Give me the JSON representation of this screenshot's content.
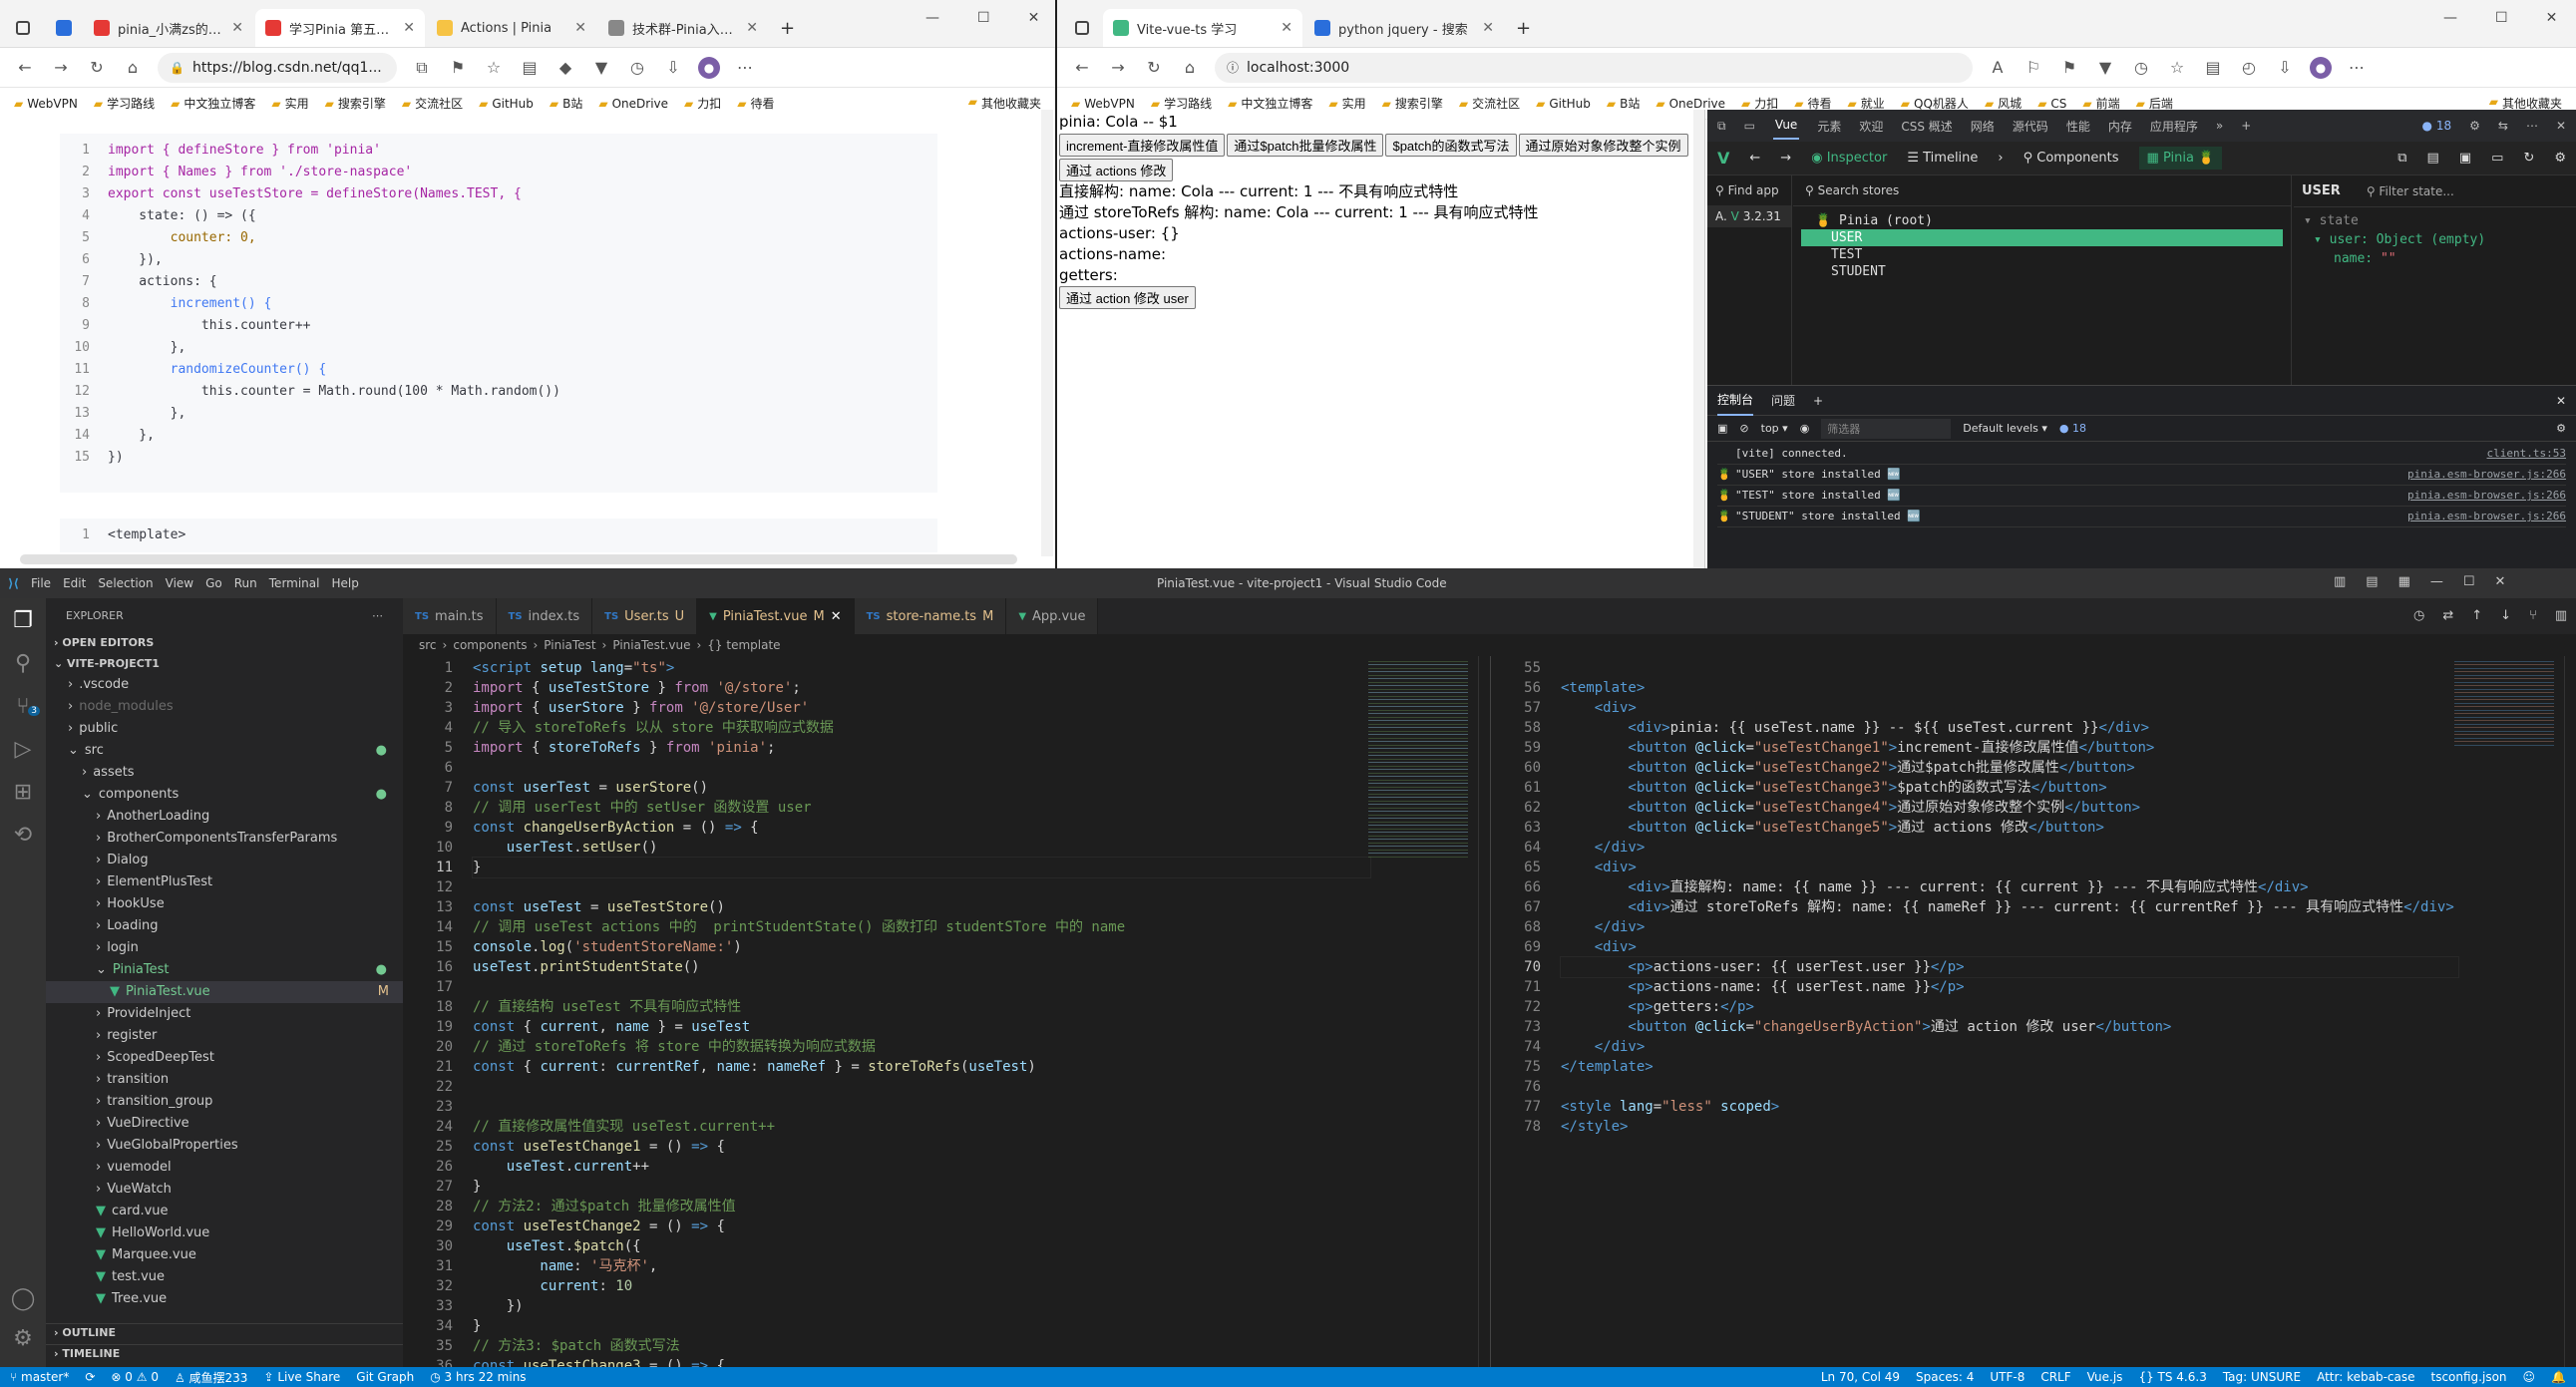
{
  "left_browser": {
    "tabs": [
      {
        "label": "pinia_小满zs的博客-CS",
        "color": "#e53935"
      },
      {
        "label": "学习Pinia 第五章（Acti",
        "color": "#e53935"
      },
      {
        "label": "Actions | Pinia",
        "color": "#f6c344"
      },
      {
        "label": "技术群-Pinia入门视频-",
        "color": "#888888"
      }
    ],
    "url": "https://blog.csdn.net/qq1...",
    "bookmarks": [
      "WebVPN",
      "学习路线",
      "中文独立博客",
      "实用",
      "搜索引擎",
      "交流社区",
      "GitHub",
      "B站",
      "OneDrive",
      "力扣",
      "待看"
    ],
    "other_bookmarks": "其他收藏夹",
    "code_lines": [
      "import { defineStore } from 'pinia'",
      "import { Names } from './store-naspace'",
      "export const useTestStore = defineStore(Names.TEST, {",
      "    state: () => ({",
      "        counter: 0,",
      "    }),",
      "    actions: {",
      "        increment() {",
      "            this.counter++",
      "        },",
      "        randomizeCounter() {",
      "            this.counter = Math.round(100 * Math.random())",
      "        },",
      "    },",
      "})"
    ],
    "code2_line": "<template>"
  },
  "right_browser": {
    "tabs": [
      {
        "label": "Vite-vue-ts 学习",
        "color": "#41b883"
      },
      {
        "label": "python jquery - 搜索",
        "color": "#2a6edb"
      }
    ],
    "url": "localhost:3000",
    "bookmarks": [
      "WebVPN",
      "学习路线",
      "中文独立博客",
      "实用",
      "搜索引擎",
      "交流社区",
      "GitHub",
      "B站",
      "OneDrive",
      "力扣",
      "待看",
      "就业",
      "QQ机器人",
      "风城",
      "CS",
      "前端",
      "后端"
    ],
    "other_bookmarks": "其他收藏夹"
  },
  "app": {
    "title_line": "pinia: Cola -- $1",
    "buttons": [
      "increment-直接修改属性值",
      "通过$patch批量修改属性",
      "$patch的函数式写法",
      "通过原始对象修改整个实例"
    ],
    "actions_button": "通过 actions 修改",
    "line1": "直接解构: name: Cola --- current: 1 --- 不具有响应式特性",
    "line2": "通过 storeToRefs 解构: name: Cola --- current: 1 --- 具有响应式特性",
    "p1": "actions-user: {}",
    "p2": "actions-name:",
    "p3": "getters:",
    "user_button": "通过 action 修改 user"
  },
  "devtools": {
    "top_tabs": [
      "Vue",
      "元素",
      "欢迎",
      "CSS 概述",
      "网络",
      "源代码",
      "性能",
      "内存",
      "应用程序"
    ],
    "issues_count": "18",
    "toolbar": {
      "inspector": "Inspector",
      "timeline": "Timeline",
      "components": "Components",
      "pinia": "Pinia"
    },
    "find_app": "Find app",
    "app_version": "3.2.31",
    "search_stores": "Search stores",
    "stores": [
      "Pinia (root)",
      "USER",
      "TEST",
      "STUDENT"
    ],
    "selected_store": "USER",
    "filter_state": "Filter state...",
    "state_label": "state",
    "state_user": "user: Object (empty)",
    "state_name_key": "name:",
    "state_name_val": "\"\"",
    "console_tabs": [
      "控制台",
      "问题"
    ],
    "context": "top",
    "filter_placeholder": "筛选器",
    "levels": "Default levels",
    "console_lines": [
      {
        "text": "[vite] connected.",
        "src": "client.ts:53"
      },
      {
        "text": "\"USER\" store installed 🆕",
        "src": "pinia.esm-browser.js:266"
      },
      {
        "text": "\"TEST\" store installed 🆕",
        "src": "pinia.esm-browser.js:266"
      },
      {
        "text": "\"STUDENT\" store installed 🆕",
        "src": "pinia.esm-browser.js:266"
      }
    ]
  },
  "vscode": {
    "menu": [
      "File",
      "Edit",
      "Selection",
      "View",
      "Go",
      "Run",
      "Terminal",
      "Help"
    ],
    "window_title": "PiniaTest.vue - vite-project1 - Visual Studio Code",
    "explorer_title": "EXPLORER",
    "open_editors": "OPEN EDITORS",
    "project": "VITE-PROJECT1",
    "tree": [
      {
        "label": ".vscode",
        "indent": 1,
        "type": "folder"
      },
      {
        "label": "node_modules",
        "indent": 1,
        "type": "folder",
        "dim": true
      },
      {
        "label": "public",
        "indent": 1,
        "type": "folder"
      },
      {
        "label": "src",
        "indent": 1,
        "type": "open",
        "dot": true
      },
      {
        "label": "assets",
        "indent": 2,
        "type": "folder"
      },
      {
        "label": "components",
        "indent": 2,
        "type": "open",
        "dot": true
      },
      {
        "label": "AnotherLoading",
        "indent": 3,
        "type": "folder"
      },
      {
        "label": "BrotherComponentsTransferParams",
        "indent": 3,
        "type": "folder"
      },
      {
        "label": "Dialog",
        "indent": 3,
        "type": "folder"
      },
      {
        "label": "ElementPlusTest",
        "indent": 3,
        "type": "folder"
      },
      {
        "label": "HookUse",
        "indent": 3,
        "type": "folder"
      },
      {
        "label": "Loading",
        "indent": 3,
        "type": "folder"
      },
      {
        "label": "login",
        "indent": 3,
        "type": "folder"
      },
      {
        "label": "PiniaTest",
        "indent": 3,
        "type": "open",
        "dot": true,
        "hl": true
      },
      {
        "label": "PiniaTest.vue",
        "indent": 4,
        "type": "vue",
        "mod": "M",
        "active": true
      },
      {
        "label": "ProvideInject",
        "indent": 3,
        "type": "folder"
      },
      {
        "label": "register",
        "indent": 3,
        "type": "folder"
      },
      {
        "label": "ScopedDeepTest",
        "indent": 3,
        "type": "folder"
      },
      {
        "label": "transition",
        "indent": 3,
        "type": "folder"
      },
      {
        "label": "transition_group",
        "indent": 3,
        "type": "folder"
      },
      {
        "label": "VueDirective",
        "indent": 3,
        "type": "folder"
      },
      {
        "label": "VueGlobalProperties",
        "indent": 3,
        "type": "folder"
      },
      {
        "label": "vuemodel",
        "indent": 3,
        "type": "folder"
      },
      {
        "label": "VueWatch",
        "indent": 3,
        "type": "folder"
      },
      {
        "label": "card.vue",
        "indent": 3,
        "type": "vue"
      },
      {
        "label": "HelloWorld.vue",
        "indent": 3,
        "type": "vue"
      },
      {
        "label": "Marquee.vue",
        "indent": 3,
        "type": "vue"
      },
      {
        "label": "test.vue",
        "indent": 3,
        "type": "vue"
      },
      {
        "label": "Tree.vue",
        "indent": 3,
        "type": "vue"
      }
    ],
    "outline": "OUTLINE",
    "timeline": "TIMELINE",
    "tabs": [
      {
        "label": "main.ts",
        "icon": "TS",
        "mod": ""
      },
      {
        "label": "index.ts",
        "icon": "TS",
        "mod": ""
      },
      {
        "label": "User.ts",
        "icon": "TS",
        "mod": "U"
      },
      {
        "label": "PiniaTest.vue",
        "icon": "V",
        "mod": "M",
        "active": true
      },
      {
        "label": "store-name.ts",
        "icon": "TS",
        "mod": "M"
      },
      {
        "label": "App.vue",
        "icon": "V",
        "mod": ""
      }
    ],
    "breadcrumb": [
      "src",
      "components",
      "PiniaTest",
      "PiniaTest.vue",
      "{} template"
    ],
    "left_start_line": 1,
    "right_start_line": 55,
    "status": {
      "branch": "master*",
      "errors": "0",
      "warnings": "0",
      "fish": "咸鱼摆233",
      "live_share": "Live Share",
      "git_graph": "Git Graph",
      "time": "3 hrs 22 mins",
      "position": "Ln 70, Col 49",
      "spaces": "Spaces: 4",
      "encoding": "UTF-8",
      "eol": "CRLF",
      "lang": "Vue.js",
      "ts": "TS 4.6.3",
      "tag": "Tag: UNSURE",
      "attr": "Attr: kebab-case",
      "tsconfig": "tsconfig.json"
    }
  },
  "colors": {
    "vue_green": "#41b883",
    "vscode_blue": "#007acc",
    "accent_blue": "#0e639c"
  }
}
